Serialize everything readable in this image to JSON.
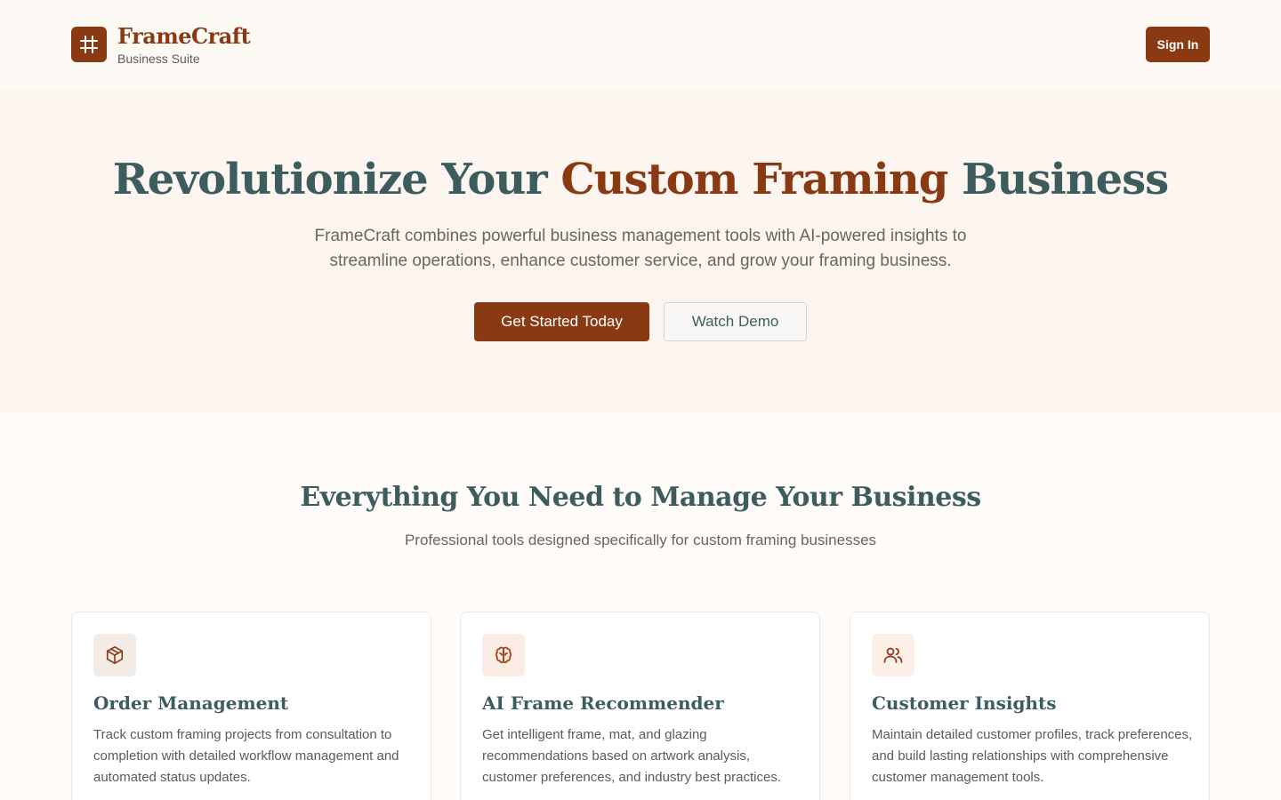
{
  "header": {
    "brand_name": "FrameCraft",
    "brand_sub": "Business Suite",
    "signin_label": "Sign In",
    "logo_icon": "frame-grid-icon"
  },
  "hero": {
    "title_part1": "Revolutionize Your ",
    "title_accent": "Custom Framing",
    "title_part2": " Business",
    "description": "FrameCraft combines powerful business management tools with AI-powered insights to streamline operations, enhance customer service, and grow your framing business.",
    "cta_primary": "Get Started Today",
    "cta_secondary": "Watch Demo"
  },
  "features": {
    "title": "Everything You Need to Manage Your Business",
    "subtitle": "Professional tools designed specifically for custom framing businesses",
    "cards": [
      {
        "icon": "package-icon",
        "title": "Order Management",
        "description": "Track custom framing projects from consultation to completion with detailed workflow management and automated status updates."
      },
      {
        "icon": "brain-icon",
        "title": "AI Frame Recommender",
        "description": "Get intelligent frame, mat, and glazing recommendations based on artwork analysis, customer preferences, and industry best practices."
      },
      {
        "icon": "users-icon",
        "title": "Customer Insights",
        "description": "Maintain detailed customer profiles, track preferences, and build lasting relationships with comprehensive customer management tools."
      }
    ]
  },
  "colors": {
    "brand": "#8a3a12",
    "heading": "#3d5c5e",
    "background": "#fdf9f5"
  }
}
